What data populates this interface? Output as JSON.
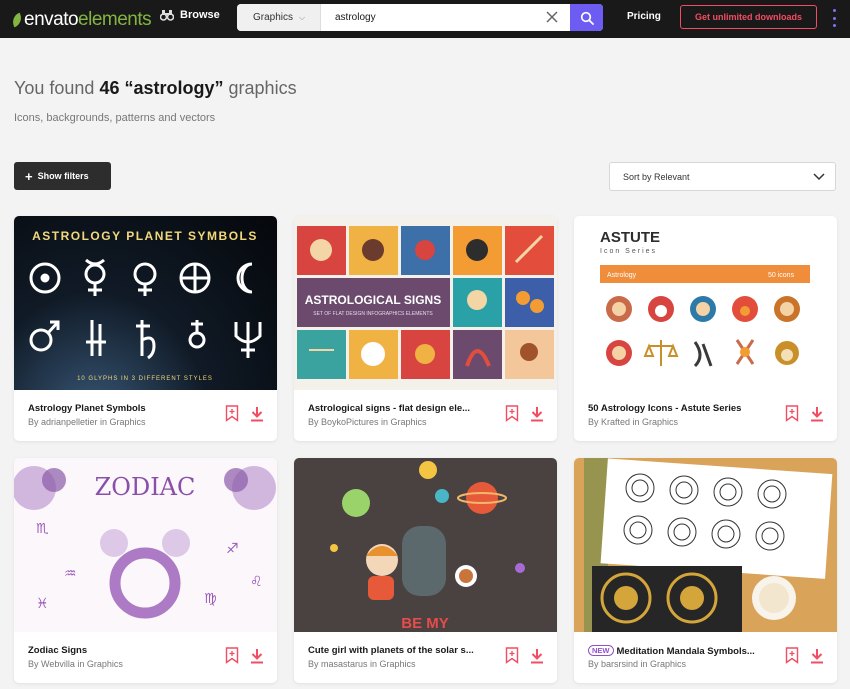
{
  "topbar": {
    "logo_prefix": "envato",
    "logo_suffix": "elements",
    "browse_label": "Browse",
    "search_category": "Graphics",
    "search_value": "astrology",
    "pricing_label": "Pricing",
    "unlimited_label": "Get unlimited downloads"
  },
  "results": {
    "prefix": "You found",
    "count": "46",
    "query": "“astrology”",
    "suffix": "graphics",
    "subtitle": "Icons, backgrounds, patterns and vectors"
  },
  "controls": {
    "filters_label": "Show filters",
    "sort_label": "Sort by Relevant"
  },
  "thumb_text": {
    "c1_title": "ASTROLOGY PLANET SYMBOLS",
    "c1_footer": "10 GLYPHS IN 3 DIFFERENT STYLES",
    "c2_banner": "ASTROLOGICAL SIGNS",
    "c2_banner_sub": "SET OF FLAT DESIGN INFOGRAPHICS ELEMENTS",
    "c3_title": "ASTUTE",
    "c3_sub": "Icon Series",
    "c3_bar_left": "Astrology",
    "c3_bar_right": "50 icons",
    "c4_title": "ZODIAC",
    "c5_text": "BE MY"
  },
  "cards": [
    {
      "title": "Astrology Planet Symbols",
      "author": "By adrianpelletier in Graphics"
    },
    {
      "title": "Astrological signs - flat design ele...",
      "author": "By BoykoPictures in Graphics"
    },
    {
      "title": "50 Astrology Icons - Astute Series",
      "author": "By Krafted in Graphics"
    },
    {
      "title": "Zodiac Signs",
      "author": "By Webvilla in Graphics"
    },
    {
      "title": "Cute girl with planets of the solar s...",
      "author": "By masastarus in Graphics"
    },
    {
      "title": "Meditation Mandala Symbols...",
      "author": "By barsrsind in Graphics",
      "badge": "NEW"
    }
  ],
  "colors": {
    "accent_purple": "#6d5cf2",
    "accent_red": "#f14d63",
    "brand_green": "#82b541",
    "topbar": "#191919"
  },
  "icons": [
    "binoculars-icon",
    "close-icon",
    "search-icon",
    "more-vertical-icon",
    "plus-icon",
    "chevron-down-icon",
    "bookmark-add-icon",
    "download-icon"
  ]
}
